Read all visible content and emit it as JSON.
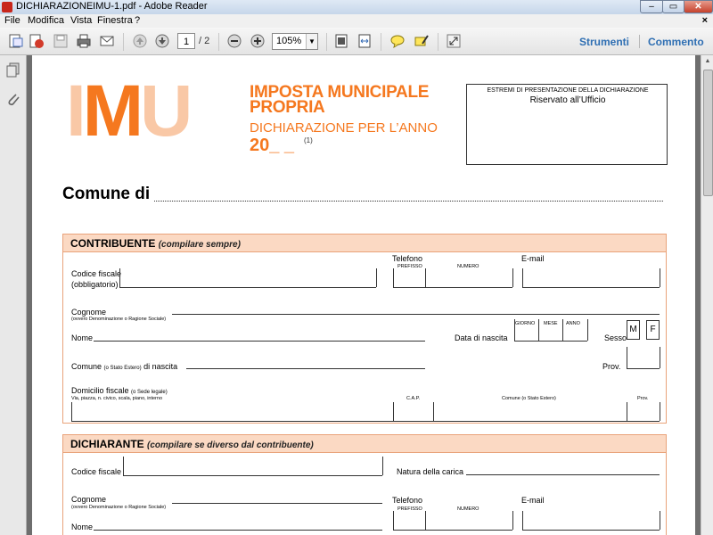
{
  "window": {
    "title": "DICHIARAZIONEIMU-1.pdf - Adobe Reader",
    "buttons": {
      "minimize": "–",
      "maximize": "▭",
      "close": "✕"
    }
  },
  "menu": {
    "items": [
      "File",
      "Modifica",
      "Vista",
      "Finestra",
      "?"
    ],
    "close_doc": "×"
  },
  "toolbar": {
    "current_page": "1",
    "total_pages": "/ 2",
    "zoom": "105%",
    "tools_label": "Strumenti",
    "comment_label": "Commento",
    "icons": [
      "create-pdf-icon",
      "edit-pdf-icon",
      "save-icon",
      "print-icon",
      "email-icon",
      "previous-page-icon",
      "next-page-icon",
      "zoom-out-icon",
      "zoom-in-icon",
      "fit-page-icon",
      "fit-width-icon",
      "comment-icon",
      "highlight-icon",
      "full-screen-icon"
    ]
  },
  "colors": {
    "accent": "#f5781f",
    "accent_light": "#f9c8a6",
    "section_bg": "#fbd9c3",
    "link": "#2f6fb3"
  },
  "document": {
    "logo": {
      "i": "I",
      "m": "M",
      "u": "U"
    },
    "title_line1": "IMPOSTA MUNICIPALE",
    "title_line2": "PROPRIA",
    "subtitle": "DICHIARAZIONE PER L’ANNO",
    "year": "20_ _",
    "year_note": "(1)",
    "office_box": {
      "line1": "ESTREMI DI PRESENTAZIONE DELLA DICHIARAZIONE",
      "line2": "Riservato all’Ufficio"
    },
    "comune_label": "Comune di",
    "contribuente": {
      "title": "CONTRIBUENTE",
      "note": "(compilare sempre)",
      "codice_fiscale": "Codice fiscale",
      "obbligatorio": "(obbligatorio)",
      "telefono": "Telefono",
      "prefisso": "PREFISSO",
      "numero": "NUMERO",
      "email": "E-mail",
      "cognome": "Cognome",
      "cognome_note": "(ovvero Denominazione o Ragione Sociale)",
      "nome": "Nome",
      "data_nascita": "Data di nascita",
      "giorno": "GIORNO",
      "mese": "MESE",
      "anno": "ANNO",
      "sesso": "Sesso",
      "m": "M",
      "f": "F",
      "comune_nascita_a": "Comune",
      "comune_nascita_b": "(o Stato Estero)",
      "comune_nascita_c": "di nascita",
      "prov": "Prov.",
      "domicilio": "Domicilio fiscale",
      "domicilio_note": "(o Sede legale)",
      "via": "Via, piazza, n. civico, scala, piano, interno",
      "cap": "C.A.P.",
      "comune_estero": "Comune (o Stato Estero)",
      "prov_small": "Prov."
    },
    "dichiarante": {
      "title": "DICHIARANTE",
      "note": "(compilare se diverso dal contribuente)",
      "codice_fiscale": "Codice fiscale",
      "natura_carica": "Natura della carica",
      "cognome": "Cognome",
      "cognome_note": "(ovvero Denominazione o Ragione Sociale)",
      "telefono": "Telefono",
      "prefisso": "PREFISSO",
      "numero": "NUMERO",
      "email": "E-mail",
      "nome": "Nome"
    }
  }
}
